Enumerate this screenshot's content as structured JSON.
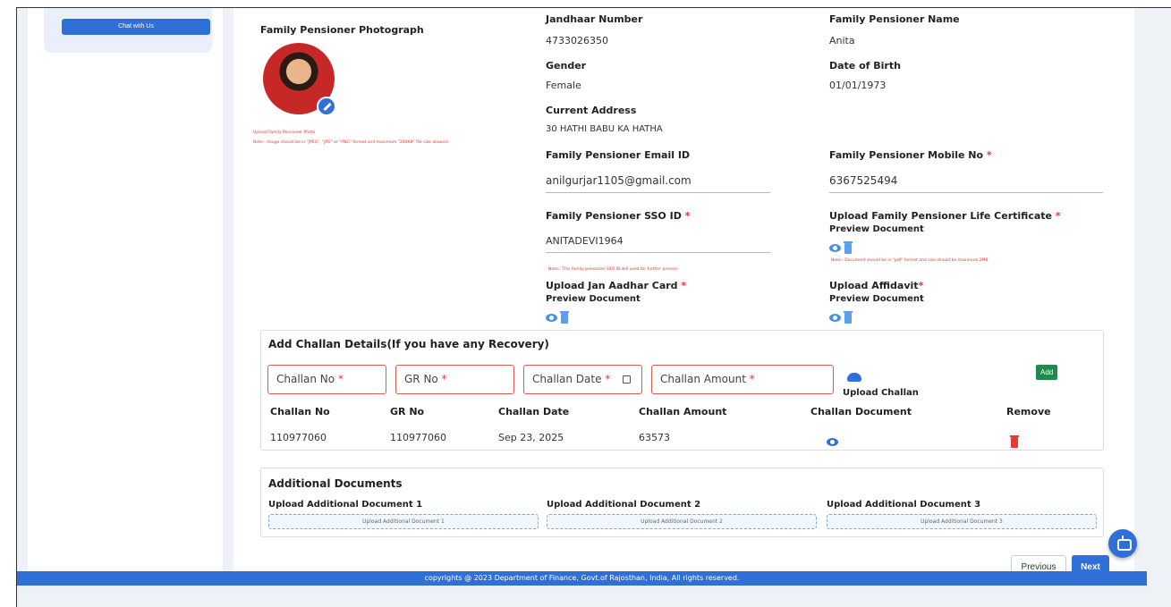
{
  "sidebar": {
    "chat_label": "Chat with Us"
  },
  "profile": {
    "photo_title": "Family Pensioner Photograph",
    "photo_note1": "Upload Family Pensioner Photo",
    "photo_note2": "Note:- Image should be in \"JPEG\", \"JPG\" or \"PNG\" format and maximum \"200KB\" file size allowed.",
    "fields": {
      "aadhar_label": "Jandhaar Number",
      "aadhar_value": "4733026350",
      "name_label": "Family Pensioner Name",
      "name_value": "Anita",
      "gender_label": "Gender",
      "gender_value": "Female",
      "dob_label": "Date of Birth",
      "dob_value": "01/01/1973",
      "address_label": "Current Address",
      "address_value": "30 HATHI BABU KA HATHA",
      "email_label": "Family Pensioner Email ID",
      "email_value": "anilgurjar1105@gmail.com",
      "mobile_label": "Family Pensioner Mobile No",
      "mobile_value": "6367525494",
      "sso_label": "Family Pensioner SSO ID",
      "sso_value": "ANITADEVI1964",
      "sso_note": "Note:- This family pensioner SSO ID will used for further process",
      "life_cert_label": "Upload Family Pensioner Life Certificate",
      "life_cert_preview": "Preview Document",
      "life_cert_note": "Note:- Document should be in \"pdf\" format and size should be maximum 2MB",
      "jan_aadhar_label": "Upload Jan Aadhar Card",
      "jan_aadhar_preview": "Preview Document",
      "affidavit_label": "Upload Affidavit",
      "affidavit_preview": "Preview Document",
      "required_mark": "*"
    }
  },
  "challan": {
    "title": "Add Challan Details(If you have any Recovery)",
    "inputs": {
      "challan_no": "Challan No",
      "gr_no": "GR No",
      "challan_date": "Challan Date",
      "challan_amount": "Challan Amount"
    },
    "upload_label": "Upload Challan",
    "add_label": "Add",
    "columns": [
      "Challan No",
      "GR No",
      "Challan Date",
      "Challan Amount",
      "Challan Document",
      "Remove"
    ],
    "rows": [
      {
        "challan_no": "110977060",
        "gr_no": "110977060",
        "date": "Sep 23, 2025",
        "amount": "63573"
      }
    ]
  },
  "additional": {
    "title": "Additional Documents",
    "docs": [
      {
        "label": "Upload Additional Document 1",
        "button": "Upload Additional Document 1"
      },
      {
        "label": "Upload Additional Document 2",
        "button": "Upload Additional Document 2"
      },
      {
        "label": "Upload Additional Document 3",
        "button": "Upload Additional Document 3"
      }
    ]
  },
  "nav": {
    "previous": "Previous",
    "next": "Next"
  },
  "footer": {
    "text": "copyrights @ 2023 Department of Finance, Govt.of Rajosthan, India, All rights reserved."
  },
  "colors": {
    "primary": "#2f6fd8",
    "required": "#e53935",
    "add_button": "#1f8a4c"
  }
}
